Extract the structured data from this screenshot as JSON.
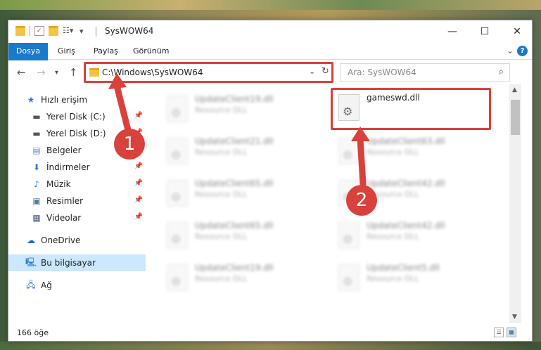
{
  "window": {
    "title": "SysWOW64",
    "minimize": "—",
    "maximize": "☐",
    "close": "✕"
  },
  "ribbon": {
    "tabs": [
      "Dosya",
      "Giriş",
      "Paylaş",
      "Görünüm"
    ],
    "help": "?"
  },
  "address": {
    "path": "C:\\Windows\\SysWOW64",
    "search_placeholder": "Ara: SysWOW64"
  },
  "sidebar": {
    "items": [
      {
        "label": "Hızlı erişim",
        "icon": "star-icon"
      },
      {
        "label": "Yerel Disk (C:)",
        "icon": "drive-icon",
        "pinned": true
      },
      {
        "label": "Yerel Disk (D:)",
        "icon": "drive-icon",
        "pinned": true
      },
      {
        "label": "Belgeler",
        "icon": "document-icon",
        "pinned": true
      },
      {
        "label": "İndirmeler",
        "icon": "download-icon",
        "pinned": true
      },
      {
        "label": "Müzik",
        "icon": "music-icon",
        "pinned": true
      },
      {
        "label": "Resimler",
        "icon": "pictures-icon",
        "pinned": true
      },
      {
        "label": "Videolar",
        "icon": "video-icon",
        "pinned": true
      },
      {
        "label": "OneDrive",
        "icon": "cloud-icon"
      },
      {
        "label": "Bu bilgisayar",
        "icon": "computer-icon",
        "selected": true
      },
      {
        "label": "Ağ",
        "icon": "network-icon"
      }
    ]
  },
  "files": {
    "left": [
      {
        "name": "UpdateClient19.dll",
        "type": "Resource DLL"
      },
      {
        "name": "UpdateClient21.dll",
        "type": "Resource DLL"
      },
      {
        "name": "UpdateClient65.dll",
        "type": "Resource DLL"
      },
      {
        "name": "UpdateClient65.dll",
        "type": "Resource DLL"
      },
      {
        "name": "UpdateClient19.dll",
        "type": "Resource DLL"
      }
    ],
    "right": [
      {
        "name": "gameswd.dll",
        "type": ""
      },
      {
        "name": "UpdateClient63.dll",
        "type": "Resource DLL"
      },
      {
        "name": "UpdateClient42.dll",
        "type": "Resource DLL"
      },
      {
        "name": "UpdateClient42.dll",
        "type": "Resource DLL"
      },
      {
        "name": "UpdateClient5.dll",
        "type": "Resource DLL"
      }
    ]
  },
  "status": {
    "item_count": "166 öğe"
  },
  "annotations": {
    "step1": "1",
    "step2": "2",
    "accent_color": "#d9413c"
  }
}
